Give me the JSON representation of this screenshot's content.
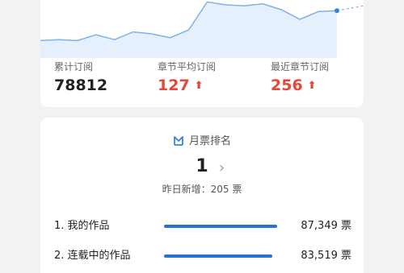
{
  "stats": {
    "total_subs": {
      "label": "累计订阅",
      "value": "78812"
    },
    "avg_chapter_subs": {
      "label": "章节平均订阅",
      "value": "127",
      "trend": "up"
    },
    "latest_chapter_subs": {
      "label": "最近章节订阅",
      "value": "256",
      "trend": "up"
    }
  },
  "chart_data": {
    "type": "area",
    "values": [
      18,
      19,
      18,
      24,
      19,
      27,
      25,
      21,
      29,
      58,
      55,
      54,
      56,
      50,
      40,
      48,
      49
    ],
    "ylim": [
      0,
      60
    ],
    "line_color": "#7fb0ea",
    "fill_color": "#e6f0fc",
    "marker_color": "#3b82e0"
  },
  "rank": {
    "icon": "ticket-icon",
    "title": "月票排名",
    "number": "1",
    "yesterday_added": "昨日新增：205 票",
    "rows": [
      {
        "name": "1. 我的作品",
        "tickets": "87,349 票",
        "bar_fill": 1.0
      },
      {
        "name": "2. 连载中的作品",
        "tickets": "83,519 票",
        "bar_fill": 0.96
      }
    ]
  },
  "colors": {
    "accent_red": "#e8453c",
    "accent_blue": "#2a6fd6"
  }
}
